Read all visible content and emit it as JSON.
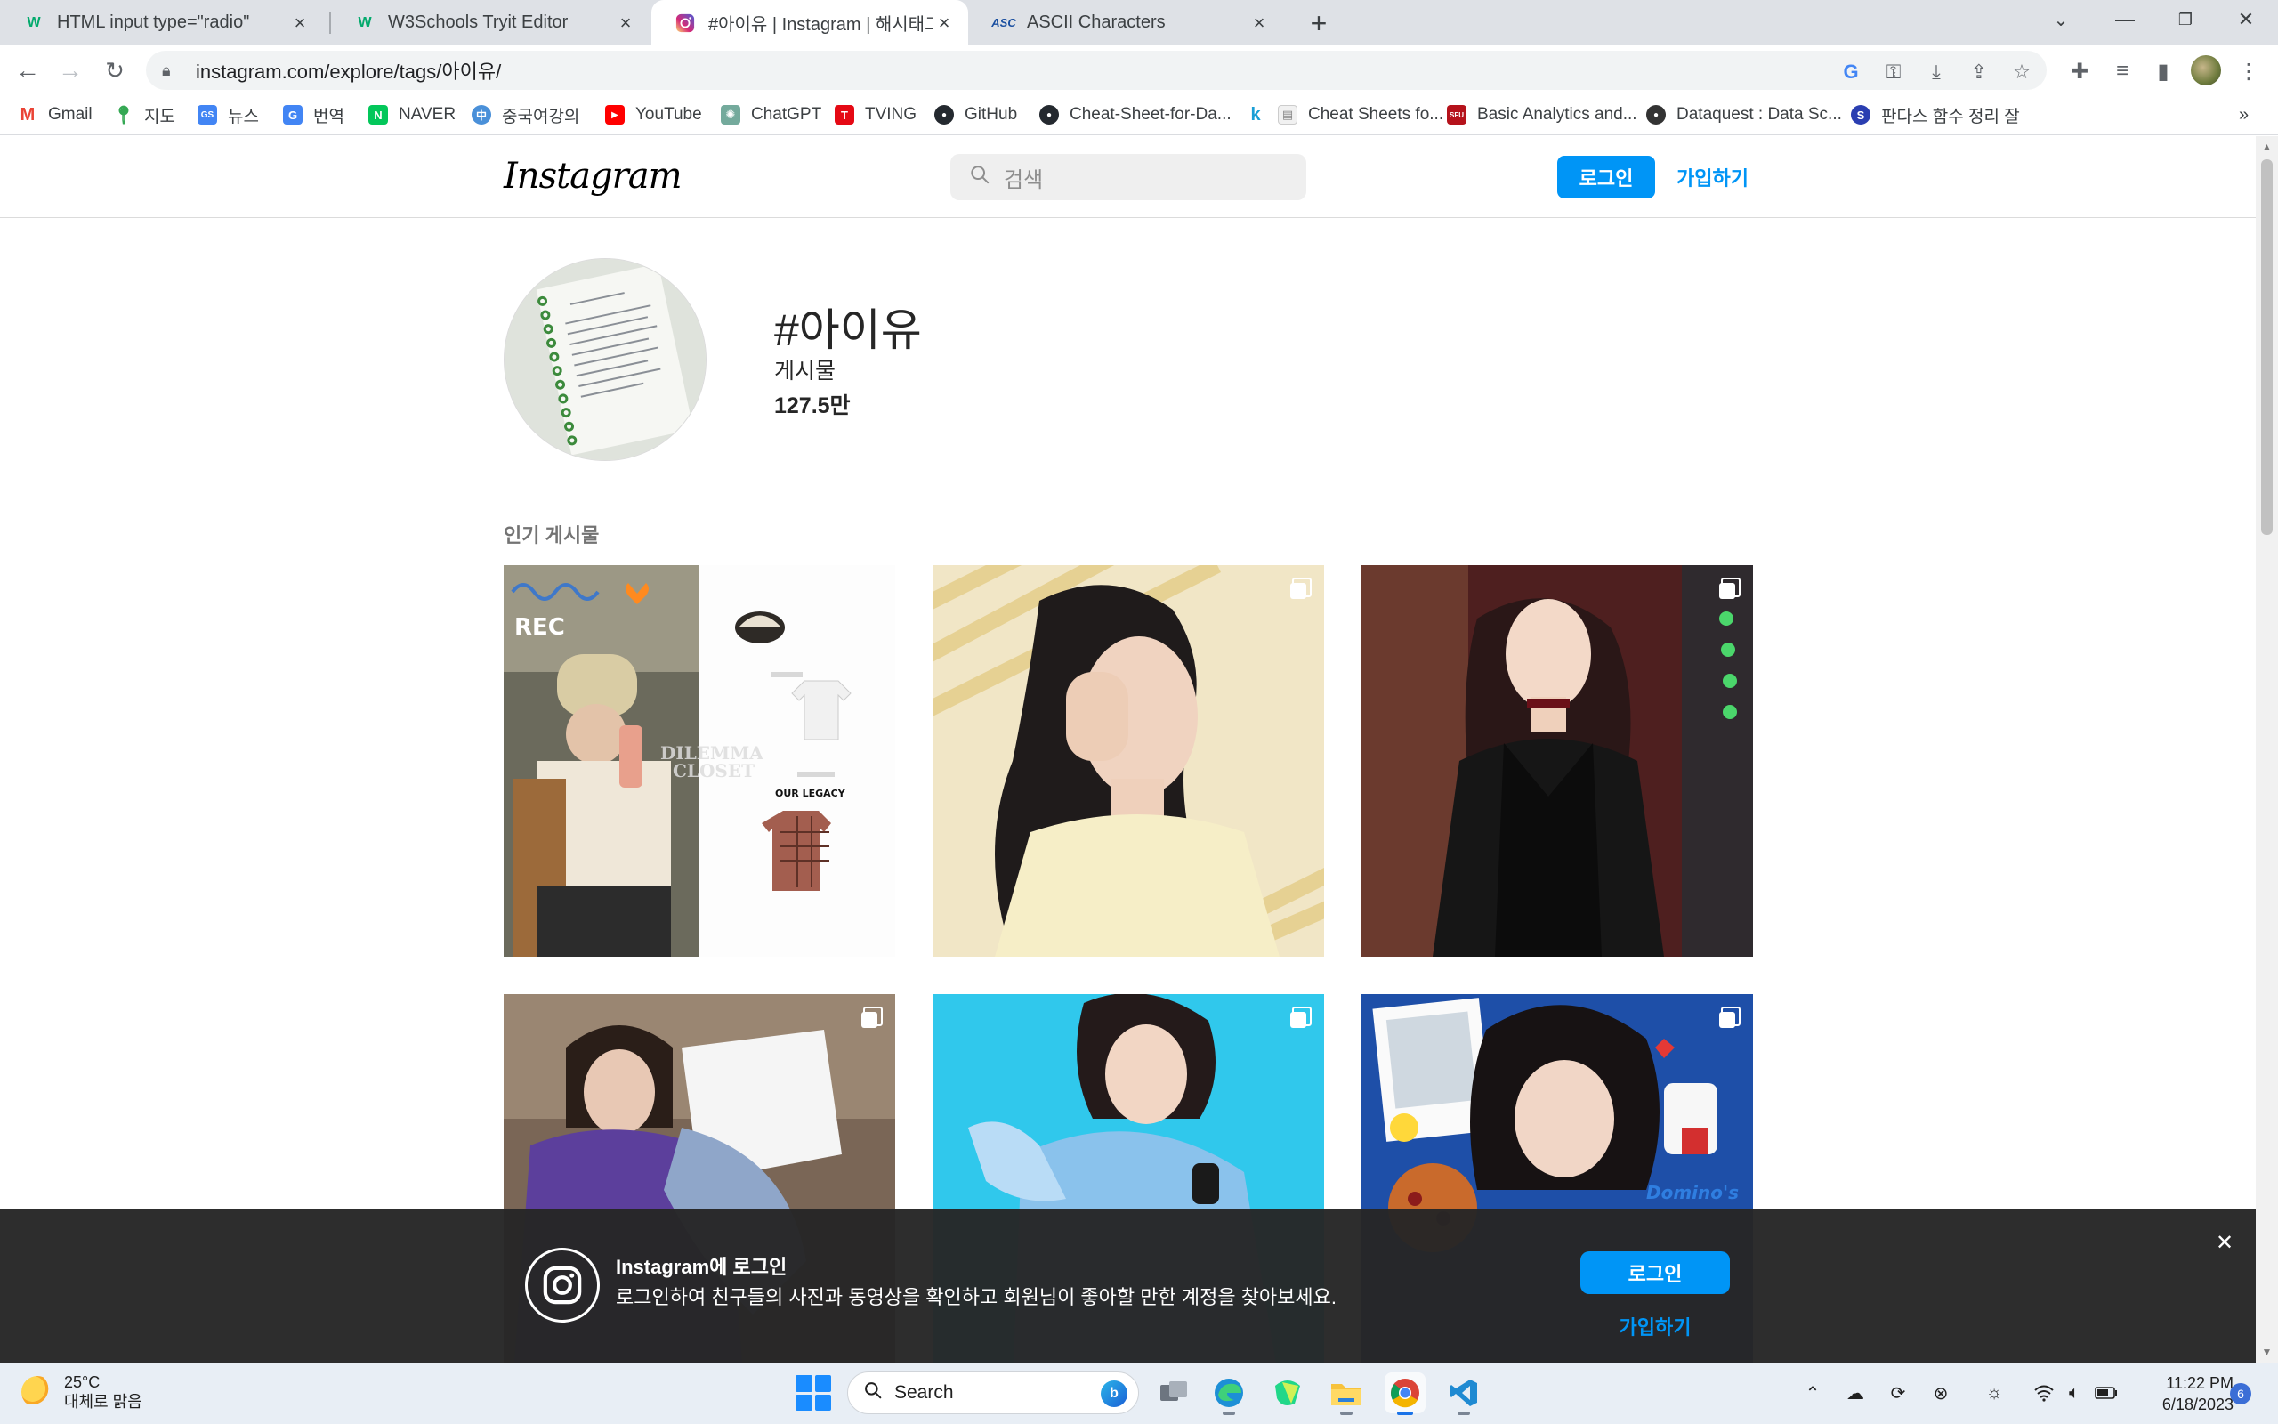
{
  "browser": {
    "tabs": [
      {
        "title": "HTML input type=\"radio\"",
        "icon": "w3schools-icon",
        "favicon": "W",
        "active": false
      },
      {
        "title": "W3Schools Tryit Editor",
        "icon": "w3schools-icon",
        "favicon": "W",
        "active": false
      },
      {
        "title": "#아이유 | Instagram | 해시태그",
        "icon": "instagram-icon",
        "favicon": "",
        "active": true
      },
      {
        "title": "ASCII Characters",
        "icon": "asc-icon",
        "favicon": "ASC",
        "active": false
      }
    ],
    "url": "instagram.com/explore/tags/아이유/",
    "bookmarks": [
      {
        "label": "Gmail",
        "icon": "gmail-icon",
        "glyph": "M",
        "color": "#ea4335"
      },
      {
        "label": "지도",
        "icon": "maps-icon",
        "glyph": "●",
        "color": "#34a853"
      },
      {
        "label": "뉴스",
        "icon": "news-icon",
        "glyph": "GS",
        "color": "#4285f4"
      },
      {
        "label": "번역",
        "icon": "translate-icon",
        "glyph": "G",
        "color": "#4285f4"
      },
      {
        "label": "NAVER",
        "icon": "naver-icon",
        "glyph": "N",
        "color": "#03c75a"
      },
      {
        "label": "중국여강의",
        "icon": "globe-icon",
        "glyph": "中",
        "color": "#4a90d9"
      },
      {
        "label": "YouTube",
        "icon": "youtube-icon",
        "glyph": "▶",
        "color": "#ff0000"
      },
      {
        "label": "ChatGPT",
        "icon": "chatgpt-icon",
        "glyph": "✺",
        "color": "#74aa9c"
      },
      {
        "label": "TVING",
        "icon": "tving-icon",
        "glyph": "T",
        "color": "#e50914"
      },
      {
        "label": "GitHub",
        "icon": "github-icon",
        "glyph": "●",
        "color": "#24292f"
      },
      {
        "label": "Cheat-Sheet-for-Da...",
        "icon": "github-icon",
        "glyph": "●",
        "color": "#24292f"
      },
      {
        "label": "",
        "icon": "k-icon",
        "glyph": "k",
        "color": "#1a9fd6"
      },
      {
        "label": "Cheat Sheets fo...",
        "icon": "document-icon",
        "glyph": "▤",
        "color": "#bbbbbb"
      },
      {
        "label": "Basic Analytics and...",
        "icon": "sfu-icon",
        "glyph": "SFU",
        "color": "#b5121b"
      },
      {
        "label": "Dataquest : Data Sc...",
        "icon": "dataquest-icon",
        "glyph": "●",
        "color": "#333333"
      },
      {
        "label": "판다스 함수 정리 잘",
        "icon": "blog-icon",
        "glyph": "S",
        "color": "#2a3eb1"
      }
    ]
  },
  "instagram": {
    "logo": "Instagram",
    "search_placeholder": "검색",
    "login_label": "로그인",
    "signup_label": "가입하기",
    "tag": {
      "title": "#아이유",
      "posts_label": "게시물",
      "posts_count": "127.5만"
    },
    "popular_heading": "인기 게시물",
    "posts": [
      {
        "type": "collage",
        "multi": false,
        "overlay_texts": [
          "REC",
          "DILEMMA",
          "CLOSET",
          "OUR LEGACY"
        ]
      },
      {
        "type": "photo",
        "multi": true
      },
      {
        "type": "photo",
        "multi": true
      },
      {
        "type": "photo",
        "multi": true
      },
      {
        "type": "photo",
        "multi": true
      },
      {
        "type": "photo",
        "multi": true,
        "overlay_texts": [
          "Domino's"
        ]
      }
    ],
    "banner": {
      "title": "Instagram에 로그인",
      "description": "로그인하여 친구들의 사진과 동영상을 확인하고 회원님이 좋아할 만한 계정을 찾아보세요.",
      "login_label": "로그인",
      "signup_label": "가입하기"
    }
  },
  "taskbar": {
    "weather_temp": "25°C",
    "weather_desc": "대체로 맑음",
    "search_label": "Search",
    "time": "11:22 PM",
    "date": "6/18/2023",
    "notification_count": "6",
    "apps": [
      "task-view",
      "edge",
      "pycharm",
      "file-explorer",
      "chrome",
      "vscode"
    ]
  }
}
